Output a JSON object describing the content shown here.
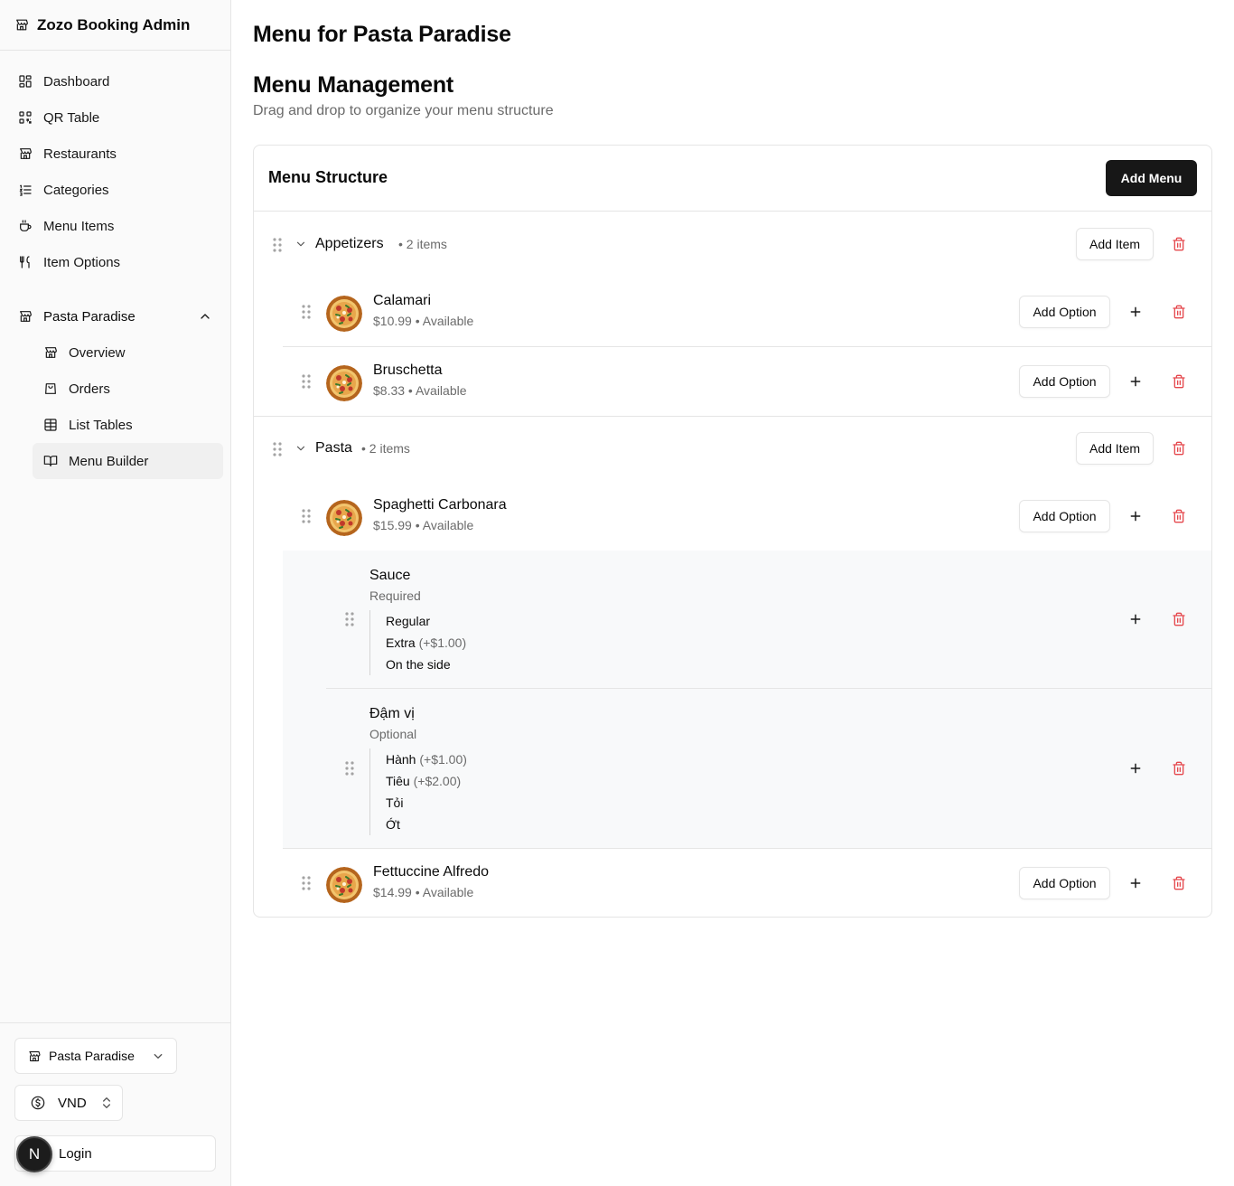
{
  "app": {
    "brand": "Zozo Booking Admin"
  },
  "sidebar": {
    "nav": [
      {
        "label": "Dashboard",
        "icon": "dashboard-icon"
      },
      {
        "label": "QR Table",
        "icon": "qr-code-icon"
      },
      {
        "label": "Restaurants",
        "icon": "store-icon"
      },
      {
        "label": "Categories",
        "icon": "list-ordered-icon"
      },
      {
        "label": "Menu Items",
        "icon": "coffee-icon"
      },
      {
        "label": "Item Options",
        "icon": "utensils-icon"
      }
    ],
    "group": {
      "label": "Pasta Paradise",
      "expanded": true,
      "items": [
        {
          "label": "Overview",
          "icon": "store-icon"
        },
        {
          "label": "Orders",
          "icon": "shopping-bag-icon"
        },
        {
          "label": "List Tables",
          "icon": "table-icon"
        },
        {
          "label": "Menu Builder",
          "icon": "book-open-icon",
          "active": true
        }
      ]
    },
    "footer": {
      "restaurant_select": "Pasta Paradise",
      "currency_select": "VND",
      "login_label": "Login",
      "avatar_letter": "N"
    }
  },
  "main": {
    "page_title": "Menu for Pasta Paradise",
    "section_title": "Menu Management",
    "section_subtitle": "Drag and drop to organize your menu structure",
    "card": {
      "title": "Menu Structure",
      "add_menu_label": "Add Menu",
      "add_item_label": "Add Item",
      "add_option_label": "Add Option",
      "categories": [
        {
          "name": "Appetizers",
          "count": "• 2 items",
          "items": [
            {
              "name": "Calamari",
              "meta": "$10.99 • Available"
            },
            {
              "name": "Bruschetta",
              "meta": "$8.33 • Available"
            }
          ]
        },
        {
          "name": "Pasta",
          "count": "• 2 items",
          "items": [
            {
              "name": "Spaghetti Carbonara",
              "meta": "$15.99 • Available",
              "options": [
                {
                  "title": "Sauce",
                  "requirement": "Required",
                  "values": [
                    {
                      "label": "Regular",
                      "price": ""
                    },
                    {
                      "label": "Extra",
                      "price": "(+$1.00)"
                    },
                    {
                      "label": "On the side",
                      "price": ""
                    }
                  ]
                },
                {
                  "title": "Đậm vị",
                  "requirement": "Optional",
                  "values": [
                    {
                      "label": "Hành",
                      "price": "(+$1.00)"
                    },
                    {
                      "label": "Tiêu",
                      "price": "(+$2.00)"
                    },
                    {
                      "label": "Tỏi",
                      "price": ""
                    },
                    {
                      "label": "Ớt",
                      "price": ""
                    }
                  ]
                }
              ]
            },
            {
              "name": "Fettuccine Alfredo",
              "meta": "$14.99 • Available"
            }
          ]
        }
      ]
    }
  },
  "colors": {
    "accent": "#171717",
    "danger": "#e5484d",
    "muted": "#6b6b6b",
    "border": "#e5e5e5"
  }
}
